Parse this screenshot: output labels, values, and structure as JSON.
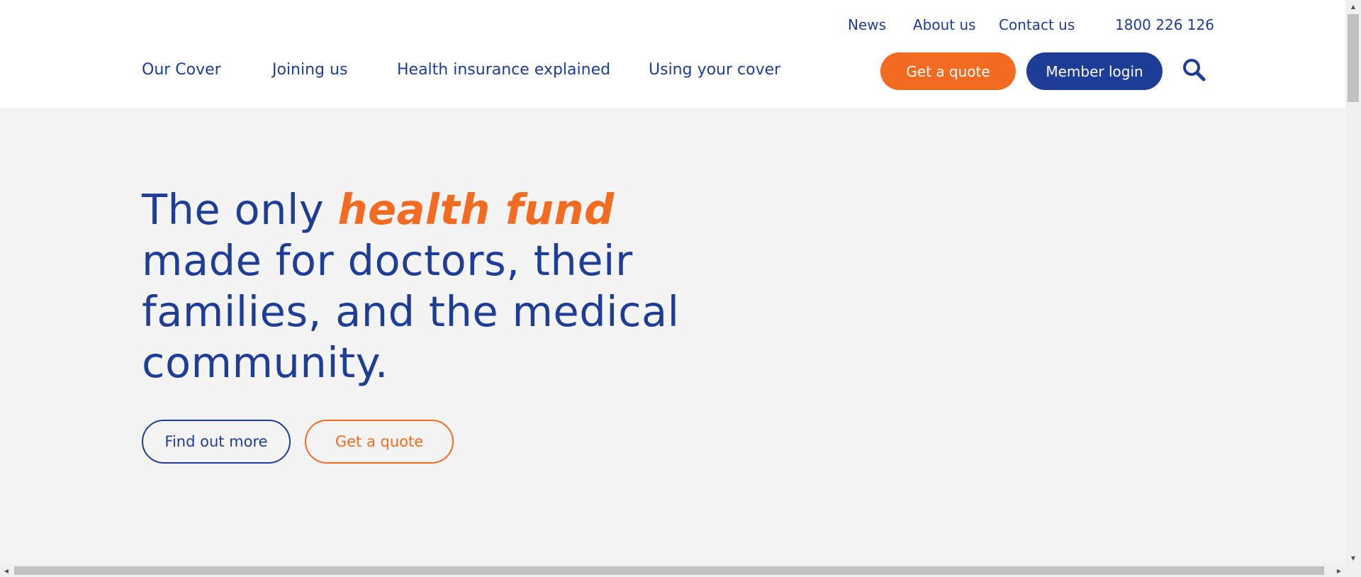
{
  "utility_nav": {
    "news": "News",
    "about": "About us",
    "contact": "Contact us",
    "phone": "1800 226 126"
  },
  "main_nav": {
    "items": [
      "Our Cover",
      "Joining us",
      "Health insurance explained",
      "Using your cover"
    ]
  },
  "header_actions": {
    "quote_label": "Get a quote",
    "login_label": "Member login",
    "search_icon": "search-icon"
  },
  "hero": {
    "title_prefix": "The only ",
    "title_accent": "health fund",
    "title_rest": "made for doctors, their families, and the medical community.",
    "find_out_more": "Find out more",
    "get_quote": "Get a quote"
  },
  "colors": {
    "brand_blue": "#1e3d96",
    "brand_orange": "#f26b21",
    "hero_background": "#f4f4f4"
  },
  "scrollbars": {
    "up_icon": "▲",
    "down_icon": "▼",
    "left_icon": "◀",
    "right_icon": "▶"
  }
}
